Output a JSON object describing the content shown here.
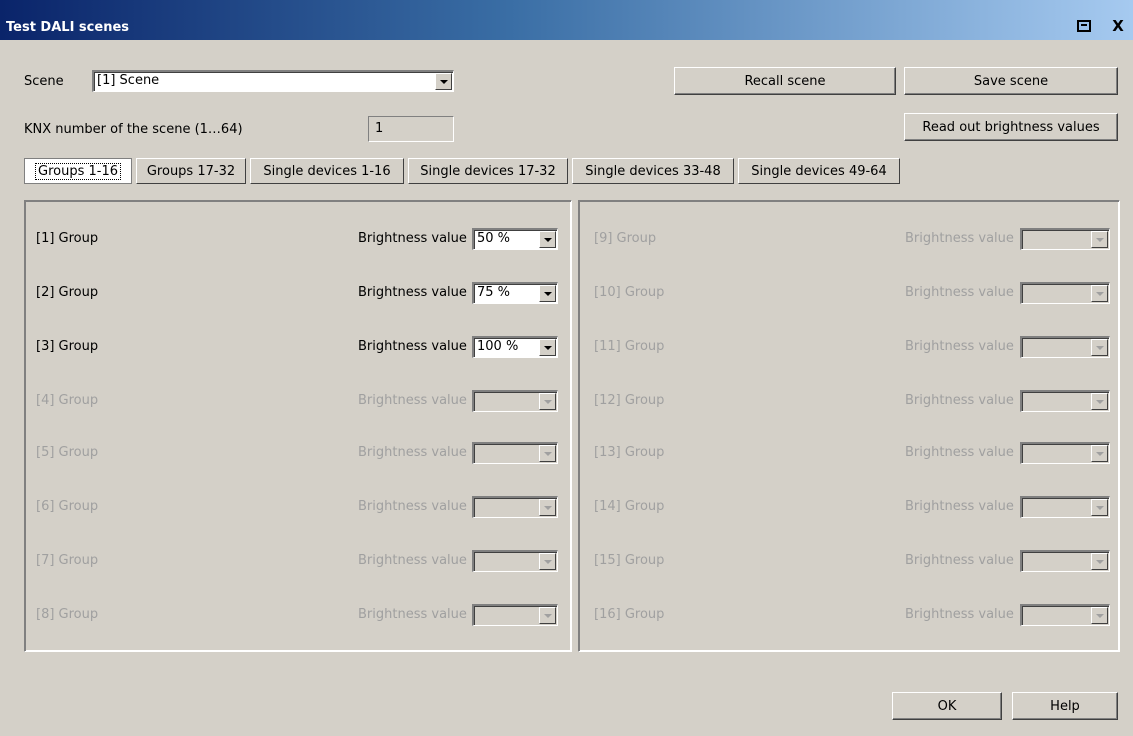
{
  "window": {
    "title": "Test DALI scenes",
    "close_label": "X"
  },
  "scene": {
    "label": "Scene",
    "selected": "[1] Scene",
    "knx_label": "KNX number of the scene (1…64)",
    "knx_value": "1"
  },
  "buttons": {
    "recall": "Recall scene",
    "save": "Save scene",
    "read_out": "Read out brightness values",
    "ok": "OK",
    "help": "Help"
  },
  "tabs": [
    "Groups 1-16",
    "Groups 17-32",
    "Single devices 1-16",
    "Single devices 17-32",
    "Single devices 33-48",
    "Single devices 49-64"
  ],
  "left_groups": [
    {
      "name": "[1] Group",
      "label": "Brightness value",
      "value": "50 %",
      "enabled": true
    },
    {
      "name": "[2] Group",
      "label": "Brightness value",
      "value": "75 %",
      "enabled": true
    },
    {
      "name": "[3] Group",
      "label": "Brightness value",
      "value": "100 %",
      "enabled": true
    },
    {
      "name": "[4] Group",
      "label": "Brightness value",
      "value": "",
      "enabled": false
    },
    {
      "name": "[5] Group",
      "label": "Brightness value",
      "value": "",
      "enabled": false
    },
    {
      "name": "[6] Group",
      "label": "Brightness value",
      "value": "",
      "enabled": false
    },
    {
      "name": "[7] Group",
      "label": "Brightness value",
      "value": "",
      "enabled": false
    },
    {
      "name": "[8] Group",
      "label": "Brightness value",
      "value": "",
      "enabled": false
    }
  ],
  "right_groups": [
    {
      "name": "[9] Group",
      "label": "Brightness value",
      "value": "",
      "enabled": false
    },
    {
      "name": "[10] Group",
      "label": "Brightness value",
      "value": "",
      "enabled": false
    },
    {
      "name": "[11] Group",
      "label": "Brightness value",
      "value": "",
      "enabled": false
    },
    {
      "name": "[12] Group",
      "label": "Brightness value",
      "value": "",
      "enabled": false
    },
    {
      "name": "[13] Group",
      "label": "Brightness value",
      "value": "",
      "enabled": false
    },
    {
      "name": "[14] Group",
      "label": "Brightness value",
      "value": "",
      "enabled": false
    },
    {
      "name": "[15] Group",
      "label": "Brightness value",
      "value": "",
      "enabled": false
    },
    {
      "name": "[16] Group",
      "label": "Brightness value",
      "value": "",
      "enabled": false
    }
  ]
}
